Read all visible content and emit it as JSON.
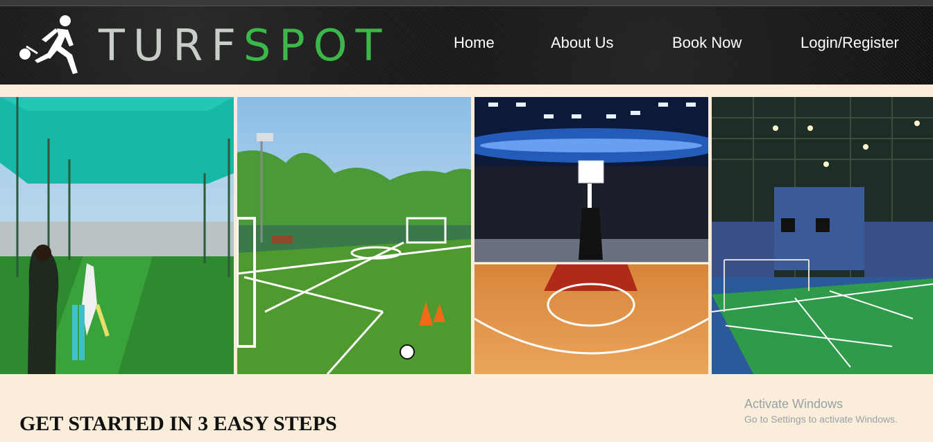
{
  "brand": {
    "name_part1": "TURF",
    "name_part2": "SPOT",
    "color_light": "#c8cfc8",
    "color_green": "#3cb84a",
    "logo_icon": "player-kicking-ball-icon"
  },
  "nav": {
    "home": "Home",
    "about": "About Us",
    "book": "Book Now",
    "login": "Login/Register"
  },
  "gallery": {
    "images": [
      {
        "name": "cricket-turf-image"
      },
      {
        "name": "football-turf-image"
      },
      {
        "name": "basketball-court-image"
      },
      {
        "name": "badminton-court-image"
      }
    ]
  },
  "section": {
    "heading": "GET STARTED IN 3 EASY STEPS"
  },
  "watermark": {
    "title": "Activate Windows",
    "subtitle": "Go to Settings to activate Windows."
  }
}
